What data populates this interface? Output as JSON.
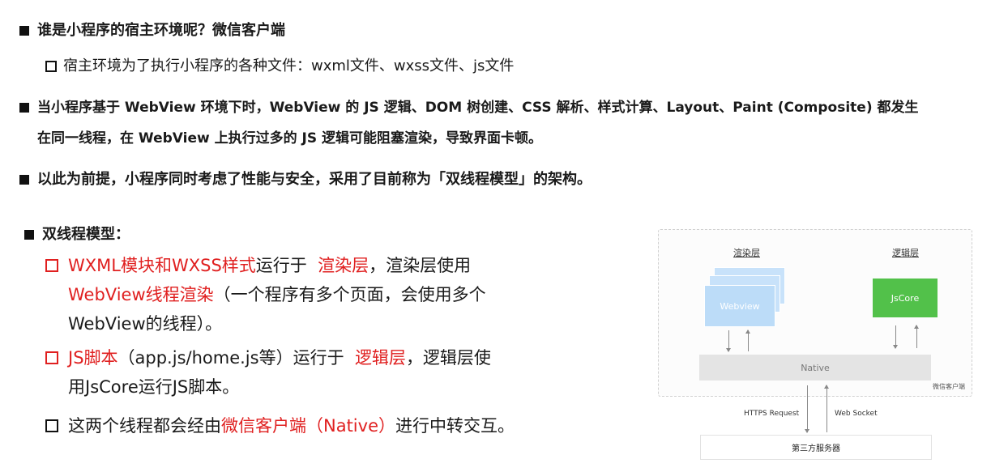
{
  "bullets": {
    "host_question": "谁是小程序的宿主环境呢？微信客户端",
    "host_detail": "宿主环境为了执行小程序的各种文件：wxml文件、wxss文件、js文件",
    "webview_line1": "当小程序基于 WebView 环境下时，WebView 的 JS 逻辑、DOM 树创建、CSS 解析、样式计算、Layout、Paint (Composite) 都发生",
    "webview_line2": "在同一线程，在 WebView 上执行过多的 JS 逻辑可能阻塞渲染，导致界面卡顿。",
    "premise": "以此为前提，小程序同时考虑了性能与安全，采用了目前称为「双线程模型」的架构。"
  },
  "model": {
    "heading": "双线程模型：",
    "item1": {
      "red1": "WXML模块和WXSS样式",
      "text1": "运行于",
      "red2": "渲染层",
      "text2": "，渲染层使用",
      "red3": "WebView线程渲染",
      "text3": "（一个程序有多个页面，会使用多个",
      "text4": "WebView的线程）。"
    },
    "item2": {
      "red1": "JS脚本",
      "text1": "（app.js/home.js等）运行于",
      "red2": "逻辑层",
      "text2": "，逻辑层使",
      "text3": "用JsCore运行JS脚本。"
    },
    "item3": {
      "text1": "这两个线程都会经由",
      "red1": "微信客户端（Native）",
      "text2": "进行中转交互。"
    }
  },
  "diagram": {
    "render_layer": "渲染层",
    "logic_layer": "逻辑层",
    "webview": "Webview",
    "jscore": "JsCore",
    "native": "Native",
    "client": "微信客户端",
    "https": "HTTPS Request",
    "websocket": "Web Socket",
    "server": "第三方服务器"
  },
  "colors": {
    "accent_red": "#e02020",
    "jscore_green": "#52c14a",
    "webview_blue": "#bcdcf8"
  }
}
